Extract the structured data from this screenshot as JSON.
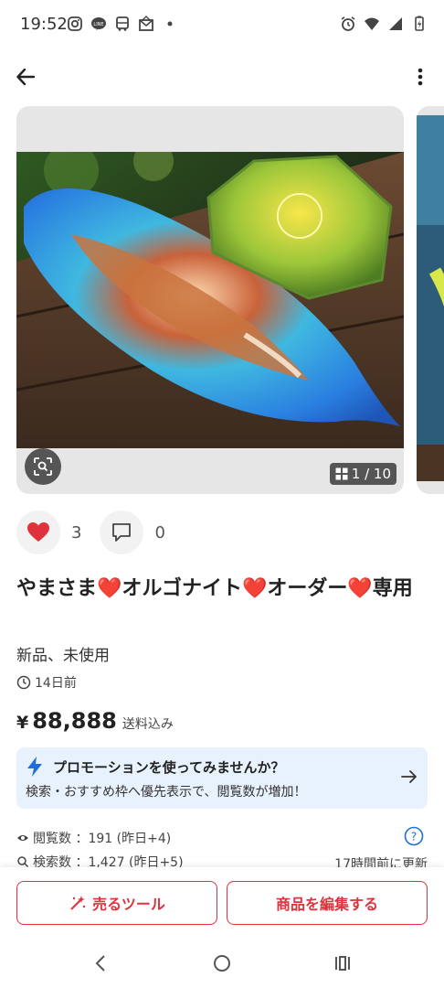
{
  "status": {
    "time": "19:52",
    "left_icons": [
      "instagram-icon",
      "line-icon",
      "bus-icon",
      "mail-icon",
      "dot-icon"
    ],
    "right_icons": [
      "alarm-icon",
      "wifi-icon",
      "signal-icon",
      "battery-icon"
    ]
  },
  "gallery": {
    "counter": "1 / 10"
  },
  "reactions": {
    "likes": "3",
    "comments": "0"
  },
  "item": {
    "title": "やまさま❤️オルゴナイト❤️オーダー❤️専用",
    "condition": "新品、未使用",
    "posted": "14日前",
    "price_symbol": "¥",
    "price": "88,888",
    "shipping": "送料込み"
  },
  "promo": {
    "title": "プロモーションを使ってみませんか？",
    "text": "検索・おすすめ枠へ優先表示で、閲覧数が増加！"
  },
  "stats": {
    "views": "閲覧数 ：191 (昨日+4)",
    "searches": "検索数 ：1,427 (昨日+5)",
    "updated": "17時間前に更新"
  },
  "buttons": {
    "sell_tool": "売るツール",
    "edit_item": "商品を編集する"
  },
  "colors": {
    "accent": "#e0323c",
    "promo_bg": "#e8f2fd",
    "bolt": "#1e6fd9"
  }
}
